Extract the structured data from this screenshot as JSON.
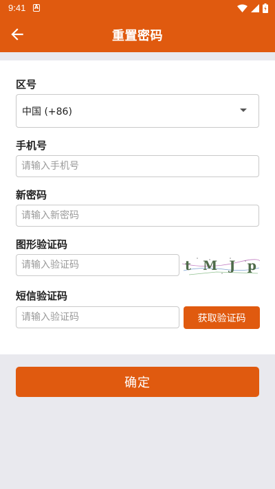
{
  "status_bar": {
    "time": "9:41",
    "notification_glyph": "A"
  },
  "app_bar": {
    "title": "重置密码"
  },
  "form": {
    "region": {
      "label": "区号",
      "value": "中国 (+86)"
    },
    "phone": {
      "label": "手机号",
      "placeholder": "请输入手机号"
    },
    "new_password": {
      "label": "新密码",
      "placeholder": "请输入新密码"
    },
    "captcha": {
      "label": "图形验证码",
      "placeholder": "请输入验证码",
      "image_text": "tMJp"
    },
    "sms_code": {
      "label": "短信验证码",
      "placeholder": "请输入验证码",
      "button_label": "获取验证码"
    }
  },
  "confirm_label": "确定",
  "colors": {
    "primary": "#e05a0f",
    "background": "#e9e9ee",
    "border": "#c9c9c9"
  }
}
